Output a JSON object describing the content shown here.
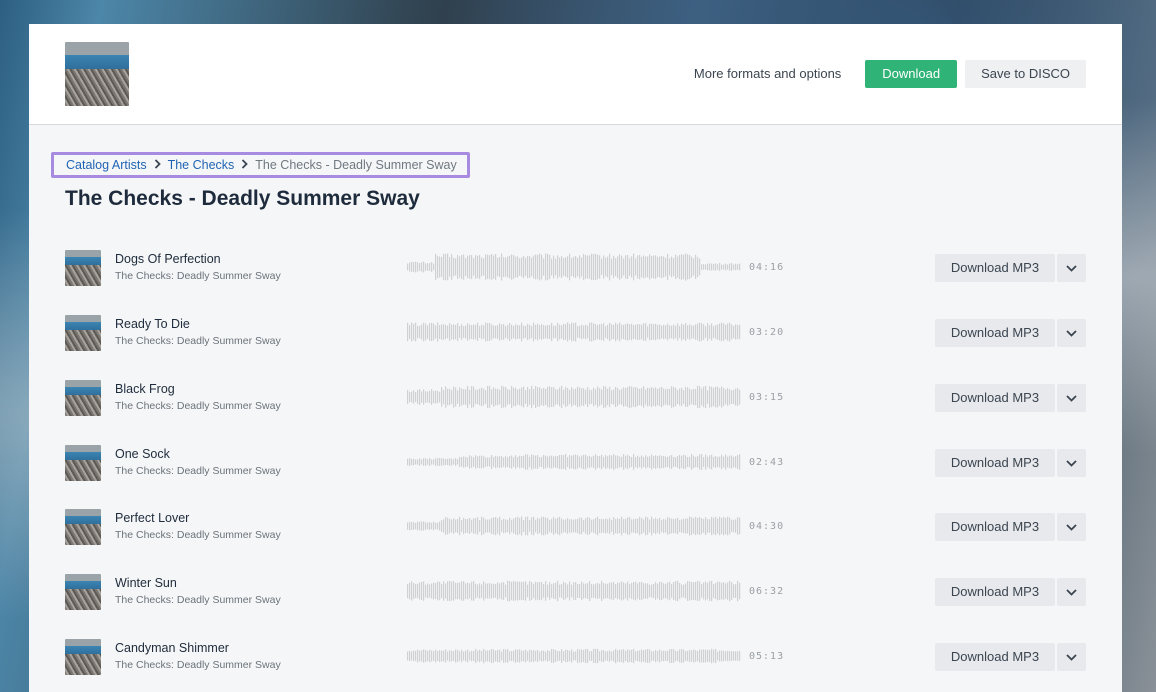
{
  "header": {
    "more_formats_label": "More formats and options",
    "download_label": "Download",
    "save_label": "Save to DISCO"
  },
  "breadcrumb": {
    "items": [
      {
        "label": "Catalog Artists"
      },
      {
        "label": "The Checks"
      }
    ],
    "current": "The Checks - Deadly Summer Sway"
  },
  "page_title": "The Checks - Deadly Summer Sway",
  "tracks": [
    {
      "title": "Dogs Of Perfection",
      "subtitle": "The Checks: Deadly Summer Sway",
      "duration": "04:16",
      "download_label": "Download MP3"
    },
    {
      "title": "Ready To Die",
      "subtitle": "The Checks: Deadly Summer Sway",
      "duration": "03:20",
      "download_label": "Download MP3"
    },
    {
      "title": "Black Frog",
      "subtitle": "The Checks: Deadly Summer Sway",
      "duration": "03:15",
      "download_label": "Download MP3"
    },
    {
      "title": "One Sock",
      "subtitle": "The Checks: Deadly Summer Sway",
      "duration": "02:43",
      "download_label": "Download MP3"
    },
    {
      "title": "Perfect Lover",
      "subtitle": "The Checks: Deadly Summer Sway",
      "duration": "04:30",
      "download_label": "Download MP3"
    },
    {
      "title": "Winter Sun",
      "subtitle": "The Checks: Deadly Summer Sway",
      "duration": "06:32",
      "download_label": "Download MP3"
    },
    {
      "title": "Candyman Shimmer",
      "subtitle": "The Checks: Deadly Summer Sway",
      "duration": "05:13",
      "download_label": "Download MP3"
    }
  ],
  "colors": {
    "accent_green": "#2fb376",
    "link_blue": "#1f64b4",
    "breadcrumb_highlight": "#a78be0",
    "waveform": "#cfd1d3"
  },
  "icons": {
    "breadcrumb_separator": "chevron-right-icon",
    "track_menu": "chevron-down-icon"
  }
}
